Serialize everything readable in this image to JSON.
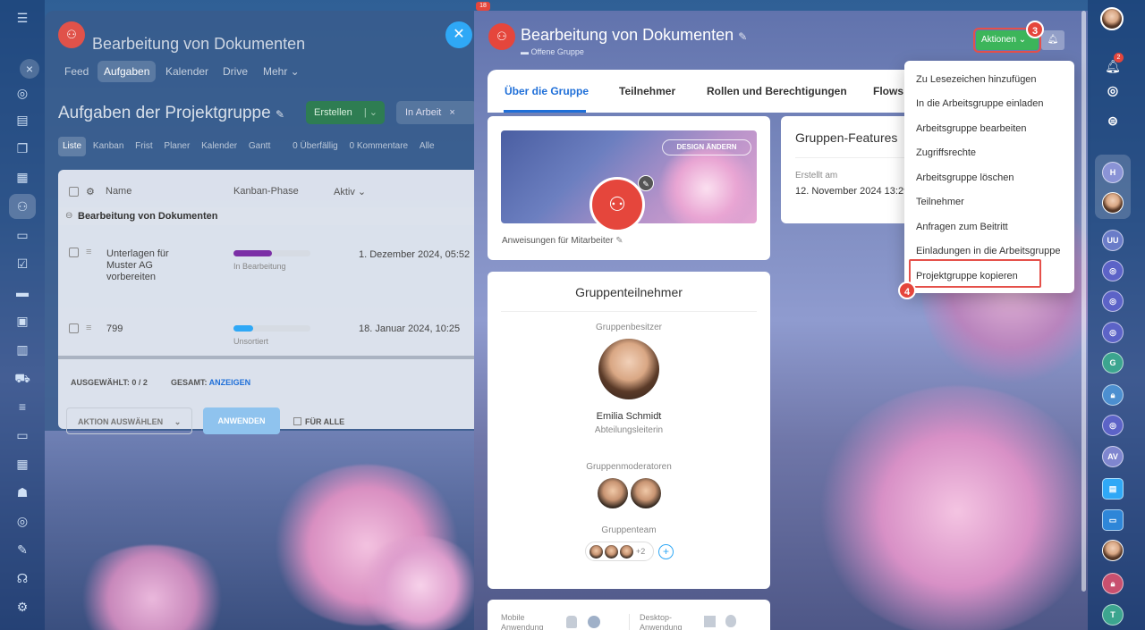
{
  "background": {
    "group_title": "Bearbeitung von Dokumenten",
    "nav": [
      "Feed",
      "Aufgaben",
      "Kalender",
      "Drive",
      "Mehr"
    ],
    "page_title": "Aufgaben der Projektgruppe",
    "create_label": "Erstellen",
    "filter_label": "In Arbeit",
    "views": [
      "Liste",
      "Kanban",
      "Frist",
      "Planer",
      "Kalender",
      "Gantt"
    ],
    "counters": [
      "0 Überfällig",
      "0 Kommentare",
      "Alle"
    ],
    "table": {
      "headers": [
        "Name",
        "Kanban-Phase",
        "Aktiv"
      ],
      "group_row": "Bearbeitung von Dokumenten",
      "rows": [
        {
          "name": "Unterlagen für Muster AG vorbereiten",
          "phase": "In Bearbeitung",
          "progress": 0.5,
          "date": "1. Dezember 2024, 05:52"
        },
        {
          "name": "799",
          "phase": "Unsortiert",
          "progress": 0.25,
          "date": "18. Januar 2024, 10:25"
        }
      ],
      "selected_label": "AUSGEWÄHLT: 0 / 2",
      "total_label": "GESAMT:",
      "total_link": "ANZEIGEN",
      "action_select": "AKTION AUSWÄHLEN",
      "apply": "ANWENDEN",
      "for_all": "FÜR ALLE"
    },
    "badge_count": "18"
  },
  "panel": {
    "title": "Bearbeitung von Dokumenten",
    "subtitle": "Offene Gruppe",
    "actions_label": "Aktionen",
    "tabs": [
      "Über die Gruppe",
      "Teilnehmer",
      "Rollen und Berechtigungen",
      "Flows"
    ],
    "design_button": "DESIGN ÄNDERN",
    "instructions_link": "Anweisungen für Mitarbeiter",
    "features_title": "Gruppen-Features",
    "created_label": "Erstellt am",
    "created_value": "12. November 2024 13:29",
    "members": {
      "title": "Gruppenteilnehmer",
      "owner_label": "Gruppenbesitzer",
      "owner_name": "Emilia Schmidt",
      "owner_role": "Abteilungsleiterin",
      "moderators_label": "Gruppenmoderatoren",
      "team_label": "Gruppenteam",
      "team_more": "+2"
    },
    "apps": {
      "mobile": "Mobile Anwendung",
      "desktop": "Desktop-Anwendung"
    }
  },
  "menu": {
    "items": [
      "Zu Lesezeichen hinzufügen",
      "In die Arbeitsgruppe einladen",
      "Arbeitsgruppe bearbeiten",
      "Zugriffsrechte",
      "Arbeitsgruppe löschen",
      "Teilnehmer",
      "Anfragen zum Beitritt",
      "Einladungen in die Arbeitsgruppe",
      "Projektgruppe kopieren"
    ]
  },
  "steps": [
    "3",
    "4"
  ],
  "right_sidebar": {
    "notification_count": "2",
    "avatars": [
      "H",
      "UU",
      "G",
      "AV",
      "T"
    ]
  },
  "colors": {
    "accent_green": "#3cb55a",
    "accent_blue": "#1f6fd8",
    "highlight_red": "#e5504a"
  }
}
